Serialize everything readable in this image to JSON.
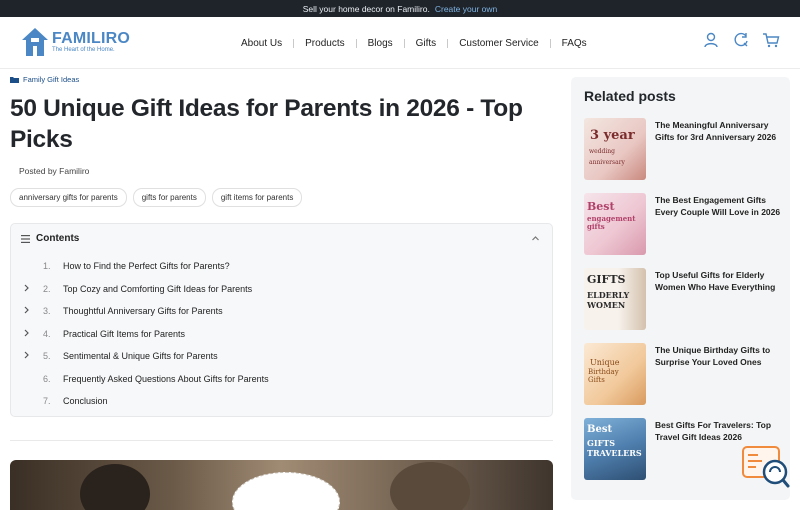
{
  "announcement": {
    "text": "Sell your home decor on Familiro.",
    "link": "Create your own"
  },
  "brand": {
    "name": "FAMILIRO",
    "tagline": "The Heart of the Home."
  },
  "nav": [
    "About Us",
    "Products",
    "Blogs",
    "Gifts",
    "Customer Service",
    "FAQs"
  ],
  "header_icons": [
    "user-icon",
    "search-refresh-icon",
    "cart-icon"
  ],
  "breadcrumb": {
    "label": "Family Gift Ideas"
  },
  "article": {
    "title": "50 Unique Gift Ideas for Parents in 2026 - Top Picks",
    "posted_by": "Posted by Familiro",
    "tags": [
      "anniversary gifts for parents",
      "gifts for parents",
      "gift items for parents"
    ]
  },
  "toc": {
    "heading": "Contents",
    "items": [
      {
        "num": "1.",
        "label": "How to Find the Perfect Gifts for Parents?",
        "expandable": false
      },
      {
        "num": "2.",
        "label": "Top Cozy and Comforting Gift Ideas for Parents",
        "expandable": true
      },
      {
        "num": "3.",
        "label": "Thoughtful Anniversary Gifts for Parents",
        "expandable": true
      },
      {
        "num": "4.",
        "label": "Practical Gift Items for Parents",
        "expandable": true
      },
      {
        "num": "5.",
        "label": "Sentimental & Unique Gifts for Parents",
        "expandable": true
      },
      {
        "num": "6.",
        "label": "Frequently Asked Questions About Gifts for Parents",
        "expandable": false
      },
      {
        "num": "7.",
        "label": "Conclusion",
        "expandable": false
      }
    ]
  },
  "sidebar": {
    "title": "Related posts",
    "posts": [
      {
        "title": "The Meaningful Anniversary Gifts for 3rd Anniversary 2026",
        "thumb_text": "3 year",
        "thumb_sub": "wedding anniversary"
      },
      {
        "title": "The Best Engagement Gifts Every Couple Will Love in 2026",
        "thumb_text": "Best",
        "thumb_sub": "engagement gifts"
      },
      {
        "title": "Top Useful Gifts for Elderly Women Who Have Everything",
        "thumb_text": "GIFTS",
        "thumb_sub": "ELDERLY WOMEN"
      },
      {
        "title": "The Unique Birthday Gifts to Surprise Your Loved Ones",
        "thumb_text": "Unique",
        "thumb_sub": "Birthday Gifts"
      },
      {
        "title": "Best Gifts For Travelers: Top Travel Gift Ideas 2026",
        "thumb_text": "Best",
        "thumb_sub": "GIFTS TRAVELERS"
      }
    ]
  },
  "colors": {
    "brand": "#4b87c4",
    "topbar": "#1f232a",
    "link": "#1c4f88",
    "chat": "#f08a3c"
  }
}
